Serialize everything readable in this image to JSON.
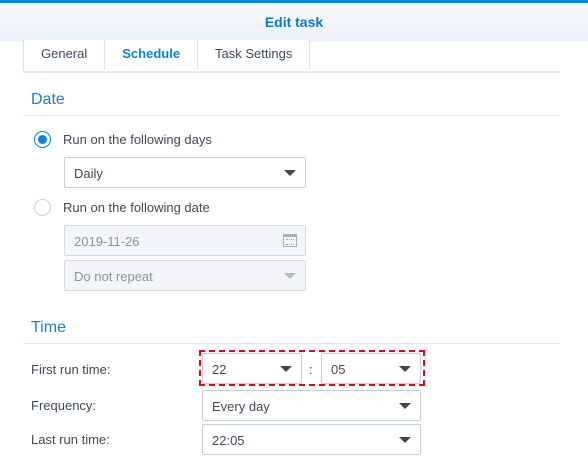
{
  "window": {
    "title": "Edit task"
  },
  "tabs": [
    {
      "label": "General",
      "active": false
    },
    {
      "label": "Schedule",
      "active": true
    },
    {
      "label": "Task Settings",
      "active": false
    }
  ],
  "date_section": {
    "title": "Date",
    "option_days": {
      "label": "Run on the following days",
      "selected": true
    },
    "days_select": {
      "value": "Daily"
    },
    "option_date": {
      "label": "Run on the following date",
      "selected": false
    },
    "date_input": {
      "value": "2019-11-26",
      "icon": "calendar-icon"
    },
    "repeat_select": {
      "value": "Do not repeat"
    }
  },
  "time_section": {
    "title": "Time",
    "first_run": {
      "label": "First run time:",
      "hour": "22",
      "separator": ":",
      "minute": "05"
    },
    "frequency": {
      "label": "Frequency:",
      "value": "Every day"
    },
    "last_run": {
      "label": "Last run time:",
      "value": "22:05"
    }
  },
  "colors": {
    "accent": "#0a83d8",
    "highlight": "#e0081b"
  }
}
